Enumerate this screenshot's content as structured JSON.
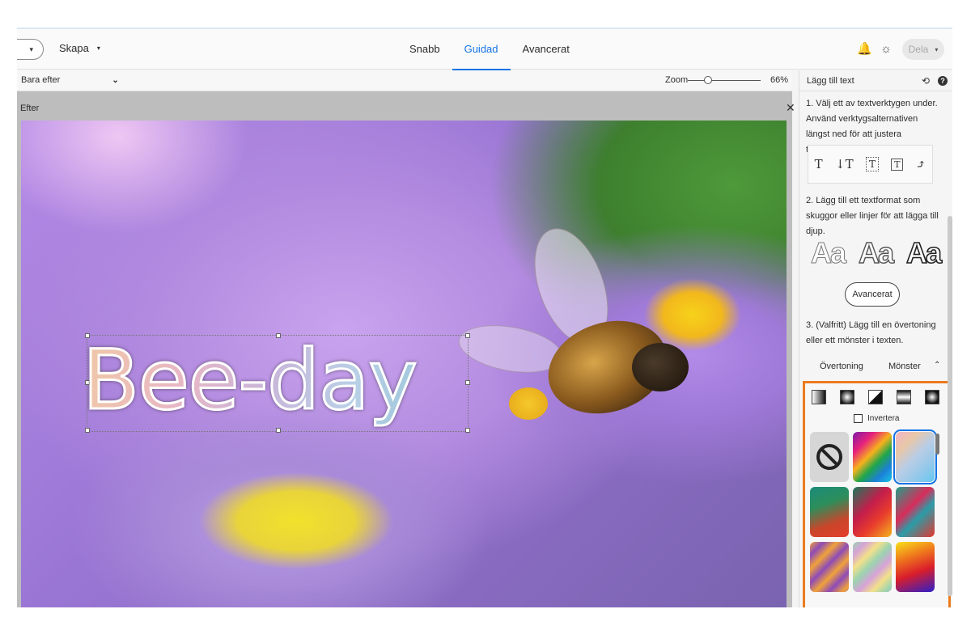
{
  "topbar": {
    "open_chevron": "▾",
    "create_label": "Skapa",
    "create_chevron": "▾",
    "modes": [
      {
        "label": "Snabb",
        "active": false
      },
      {
        "label": "Guidad",
        "active": true
      },
      {
        "label": "Avancerat",
        "active": false
      }
    ],
    "bell_icon": "bell-icon",
    "theme_icon": "sun-icon",
    "share_label": "Dela",
    "share_chevron": "▾"
  },
  "subbar": {
    "view_label": "Bara efter",
    "view_chevron": "⌄",
    "zoom_label": "Zoom",
    "zoom_value": "66%",
    "zoom_percent": 66
  },
  "canvas": {
    "after_label": "Efter",
    "close_glyph": "✕",
    "headline_text": "Bee-day"
  },
  "panel": {
    "title": "Lägg till text",
    "undo_glyph": "⟲",
    "help_glyph": "?",
    "step1": "1. Välj ett av textverktygen under. Använd verktygsalternativen längst ned för att justera textegenskaperna.",
    "tools": [
      "T",
      "↓T",
      "T",
      "T",
      "⤴"
    ],
    "step2": "2. Lägg till ett textformat som skuggor eller linjer för att lägga till djup.",
    "style_samples": [
      "Aa",
      "Aa",
      "Aa"
    ],
    "advanced_button": "Avancerat",
    "step3": "3. (Valfritt) Lägg till en övertoning eller ett mönster i texten.",
    "tab_gradient": "Övertoning",
    "tab_pattern": "Mönster",
    "collapse_chevron": "⌃",
    "invert_label": "Invertera",
    "accent_color": "#ec7b1e",
    "selection_color": "#1473e6"
  }
}
